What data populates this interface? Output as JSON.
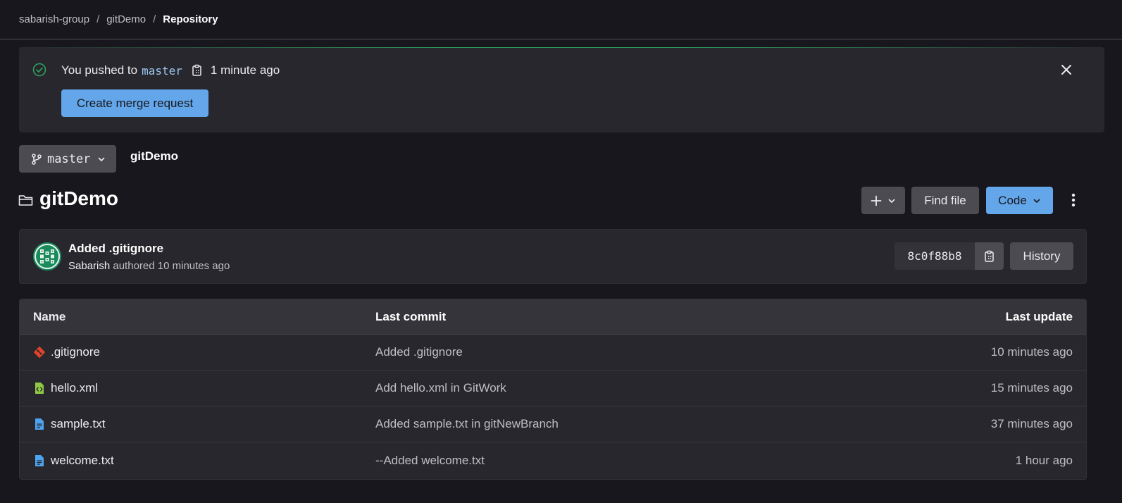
{
  "breadcrumb": {
    "items": [
      "sabarish-group",
      "gitDemo"
    ],
    "separator": "/",
    "current": "Repository"
  },
  "push_alert": {
    "text_before": "You pushed to",
    "branch": "master",
    "time": "1 minute ago",
    "button_label": "Create merge request",
    "success_color": "#2da160"
  },
  "branch_selector": {
    "value": "master"
  },
  "path": {
    "label": "gitDemo"
  },
  "repo": {
    "title": "gitDemo",
    "find_file_label": "Find file",
    "code_label": "Code"
  },
  "last_commit": {
    "title": "Added .gitignore",
    "author": "Sabarish",
    "meta_suffix": "authored 10 minutes ago",
    "sha": "8c0f88b8",
    "history_label": "History"
  },
  "file_table": {
    "headers": {
      "name": "Name",
      "last_commit": "Last commit",
      "last_update": "Last update"
    },
    "rows": [
      {
        "name": ".gitignore",
        "icon": "git-file-icon",
        "icon_color": "#e2432a",
        "last_commit": "Added .gitignore",
        "last_update": "10 minutes ago"
      },
      {
        "name": "hello.xml",
        "icon": "xml-file-icon",
        "icon_color": "#8fc747",
        "last_commit": "Add hello.xml in GitWork",
        "last_update": "15 minutes ago"
      },
      {
        "name": "sample.txt",
        "icon": "text-file-icon",
        "icon_color": "#4ea3ef",
        "last_commit": "Added sample.txt in gitNewBranch",
        "last_update": "37 minutes ago"
      },
      {
        "name": "welcome.txt",
        "icon": "text-file-icon",
        "icon_color": "#4ea3ef",
        "last_commit": "--Added welcome.txt",
        "last_update": "1 hour ago"
      }
    ]
  },
  "colors": {
    "background": "#18171d",
    "panel": "#28272d",
    "accent": "#63a6e9",
    "button": "#4c4b51"
  }
}
